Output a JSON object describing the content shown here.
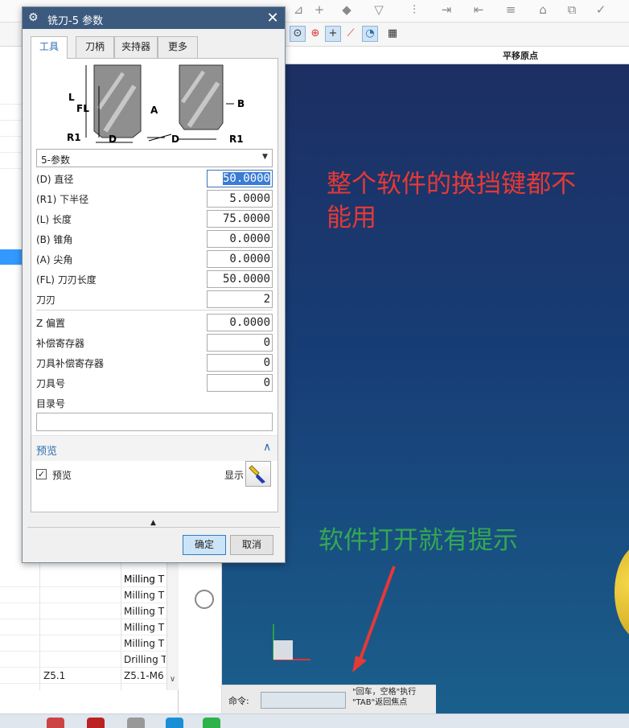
{
  "dialog": {
    "title": "铣刀-5 参数",
    "tabs": [
      {
        "label": "工具",
        "active": true
      },
      {
        "label": "刀柄",
        "active": false
      },
      {
        "label": "夹持器",
        "active": false
      },
      {
        "label": "更多",
        "active": false
      }
    ],
    "diagram_labels": {
      "L": "L",
      "FL": "FL",
      "R1_left": "R1",
      "D_left": "D",
      "A": "A",
      "B": "B",
      "D_right": "D",
      "R1_right": "R1"
    },
    "tool_type": "5-参数",
    "params": [
      {
        "label": "(D) 直径",
        "value": "50.0000"
      },
      {
        "label": "(R1) 下半径",
        "value": "5.0000"
      },
      {
        "label": "(L) 长度",
        "value": "75.0000"
      },
      {
        "label": "(B) 锥角",
        "value": "0.0000"
      },
      {
        "label": "(A) 尖角",
        "value": "0.0000"
      },
      {
        "label": "(FL) 刀刃长度",
        "value": "50.0000"
      },
      {
        "label": "刀刃",
        "value": "2"
      }
    ],
    "extra_params": [
      {
        "label": "Z 偏置",
        "value": "0.0000"
      },
      {
        "label": "补偿寄存器",
        "value": "0"
      },
      {
        "label": "刀具补偿寄存器",
        "value": "0"
      },
      {
        "label": "刀具号",
        "value": "0"
      }
    ],
    "catalog_label": "目录号",
    "catalog_value": "",
    "preview_section": "预览",
    "preview_checkbox": "预览",
    "preview_checked": true,
    "display_label": "显示",
    "ok_label": "确定",
    "cancel_label": "取消",
    "colors": {
      "titlebar": "#3c5a7e",
      "accent": "#2e6fb0"
    }
  },
  "viewport": {
    "header_title": "平移原点",
    "annotation_red": "整个软件的换挡键都不能用",
    "annotation_green": "软件打开就有提示",
    "command_label": "命令:",
    "command_hint": "\"回车，空格\"执行 \"TAB\"返回焦点",
    "colors": {
      "annotation_red": "#e53935",
      "annotation_green": "#34a853"
    }
  },
  "left_list": {
    "rows": [
      {
        "col1": "",
        "col2": "Milling T"
      },
      {
        "col1": "",
        "col2": "Milling T"
      },
      {
        "col1": "",
        "col2": "Milling T"
      },
      {
        "col1": "",
        "col2": "Milling T"
      },
      {
        "col1": "",
        "col2": "Milling T"
      },
      {
        "col1": "",
        "col2": "Milling T"
      },
      {
        "col1": "",
        "col2": "Drilling T"
      },
      {
        "col1": "Z5.1",
        "col2": "Z5.1-M6"
      }
    ]
  }
}
